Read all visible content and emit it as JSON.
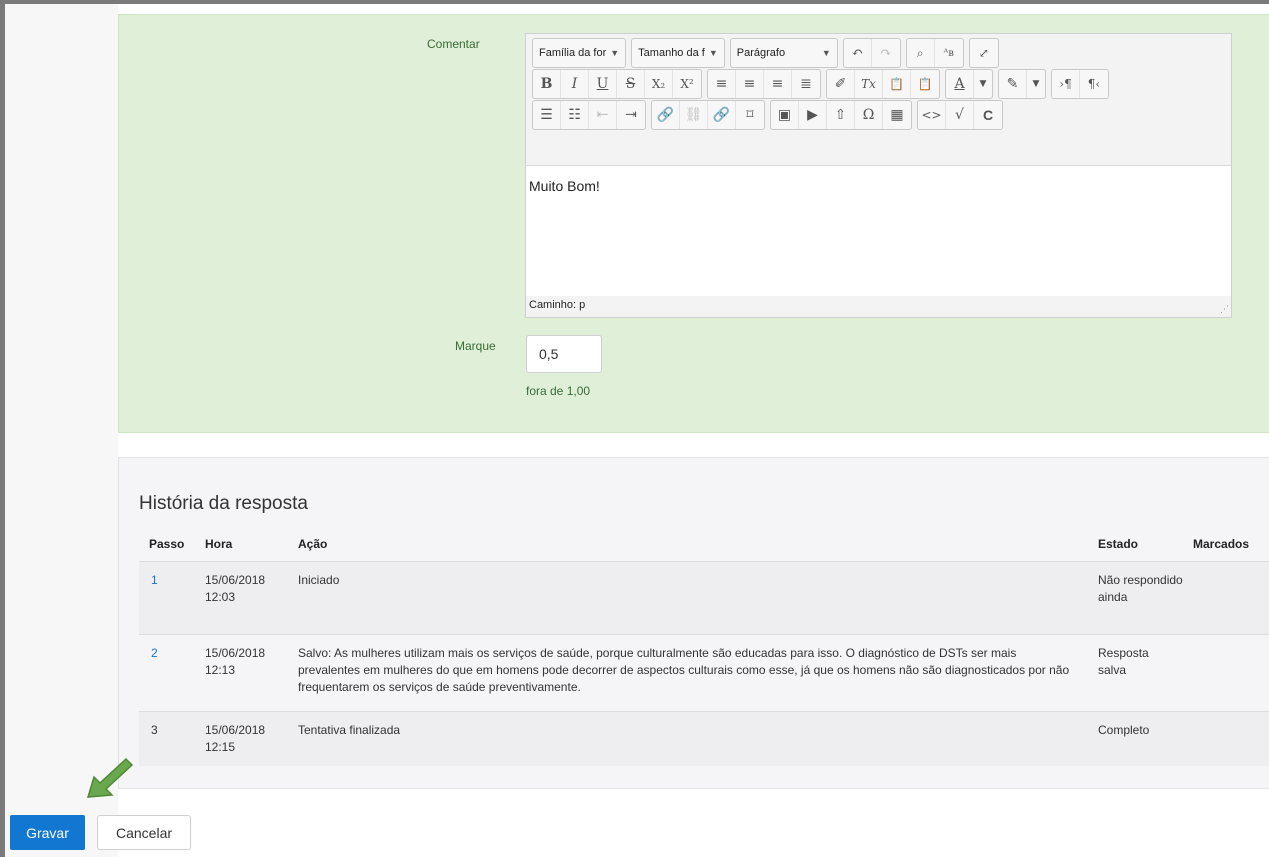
{
  "grading": {
    "comment_label": "Comentar",
    "toolbar": {
      "font_family": "Família da for",
      "font_size": "Tamanho da f",
      "paragraph": "Parágrafo"
    },
    "editor_text": "Muito Bom!",
    "path_label": "Caminho: p",
    "mark_label": "Marque",
    "mark_value": "0,5",
    "out_of": "fora de 1,00"
  },
  "history": {
    "title": "História da resposta",
    "columns": [
      "Passo",
      "Hora",
      "Ação",
      "Estado",
      "Marcados"
    ],
    "rows": [
      {
        "step": "1",
        "date": "15/06/2018",
        "time": "12:03",
        "action": "Iniciado",
        "state": "Não respondido ainda",
        "marks": ""
      },
      {
        "step": "2",
        "date": "15/06/2018",
        "time": "12:13",
        "action": "Salvo: As mulheres utilizam mais os serviços de saúde, porque culturalmente são educadas para isso. O diagnóstico de DSTs ser mais prevalentes em mulheres do que em homens pode decorrer de aspectos culturais como esse, já que os homens não são diagnosticados por não frequentarem os serviços de saúde preventivamente.",
        "state": "Resposta salva",
        "marks": ""
      },
      {
        "step": "3",
        "date": "15/06/2018",
        "time": "12:15",
        "action": "Tentativa finalizada",
        "state": "Completo",
        "marks": ""
      }
    ]
  },
  "buttons": {
    "save": "Gravar",
    "cancel": "Cancelar"
  },
  "colors": {
    "accent": "#1177d1",
    "panel_green": "#dfefd8",
    "label_green": "#3a6b35",
    "arrow_green": "#6aa84f"
  }
}
